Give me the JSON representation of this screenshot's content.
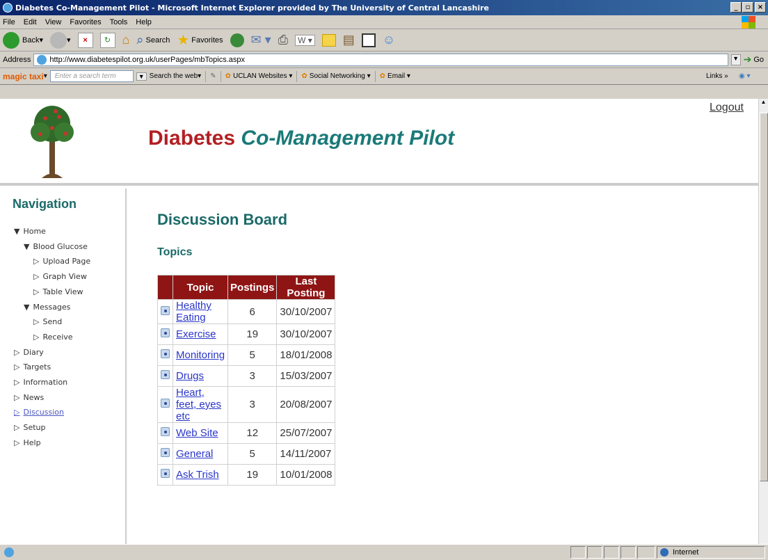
{
  "window": {
    "title": "Diabetes Co-Management Pilot - Microsoft Internet Explorer provided by The University of Central Lancashire",
    "controls": [
      "_",
      "▫",
      "×"
    ]
  },
  "menu": [
    "File",
    "Edit",
    "View",
    "Favorites",
    "Tools",
    "Help"
  ],
  "toolbar": {
    "back": "Back",
    "search": "Search",
    "favorites": "Favorites"
  },
  "address": {
    "label": "Address",
    "url": "http://www.diabetespilot.org.uk/userPages/mbTopics.aspx",
    "go": "Go"
  },
  "links_bar": {
    "brand": "magic taxi",
    "search_placeholder": "Enter a search term",
    "search_web": "Search the web",
    "items": [
      "UCLAN Websites",
      "Social Networking",
      "Email"
    ],
    "links": "Links"
  },
  "site": {
    "title_part1": "Diabetes",
    "title_part2": "Co-Management Pilot",
    "logout": "Logout"
  },
  "nav": {
    "heading": "Navigation",
    "items": [
      {
        "label": "Home",
        "marker": "▼"
      },
      {
        "label": "Blood Glucose",
        "marker": "▼"
      },
      {
        "label": "Upload Page",
        "marker": "▷"
      },
      {
        "label": "Graph View",
        "marker": "▷"
      },
      {
        "label": "Table View",
        "marker": "▷"
      },
      {
        "label": "Messages",
        "marker": "▼"
      },
      {
        "label": "Send",
        "marker": "▷"
      },
      {
        "label": "Receive",
        "marker": "▷"
      },
      {
        "label": "Diary",
        "marker": "▷"
      },
      {
        "label": "Targets",
        "marker": "▷"
      },
      {
        "label": "Information",
        "marker": "▷"
      },
      {
        "label": "News",
        "marker": "▷"
      },
      {
        "label": "Discussion",
        "marker": "▷"
      },
      {
        "label": "Setup",
        "marker": "▷"
      },
      {
        "label": "Help",
        "marker": "▷"
      }
    ]
  },
  "main": {
    "heading": "Discussion Board",
    "subheading": "Topics",
    "columns": [
      "Topic",
      "Postings",
      "Last Posting"
    ],
    "rows": [
      {
        "topic": "Healthy Eating",
        "postings": "6",
        "last": "30/10/2007"
      },
      {
        "topic": "Exercise",
        "postings": "19",
        "last": "30/10/2007"
      },
      {
        "topic": "Monitoring",
        "postings": "5",
        "last": "18/01/2008"
      },
      {
        "topic": "Drugs",
        "postings": "3",
        "last": "15/03/2007"
      },
      {
        "topic": "Heart, feet, eyes etc",
        "postings": "3",
        "last": "20/08/2007"
      },
      {
        "topic": "Web Site",
        "postings": "12",
        "last": "25/07/2007"
      },
      {
        "topic": "General",
        "postings": "5",
        "last": "14/11/2007"
      },
      {
        "topic": "Ask Trish",
        "postings": "19",
        "last": "10/01/2008"
      }
    ]
  },
  "status": {
    "zone": "Internet"
  }
}
